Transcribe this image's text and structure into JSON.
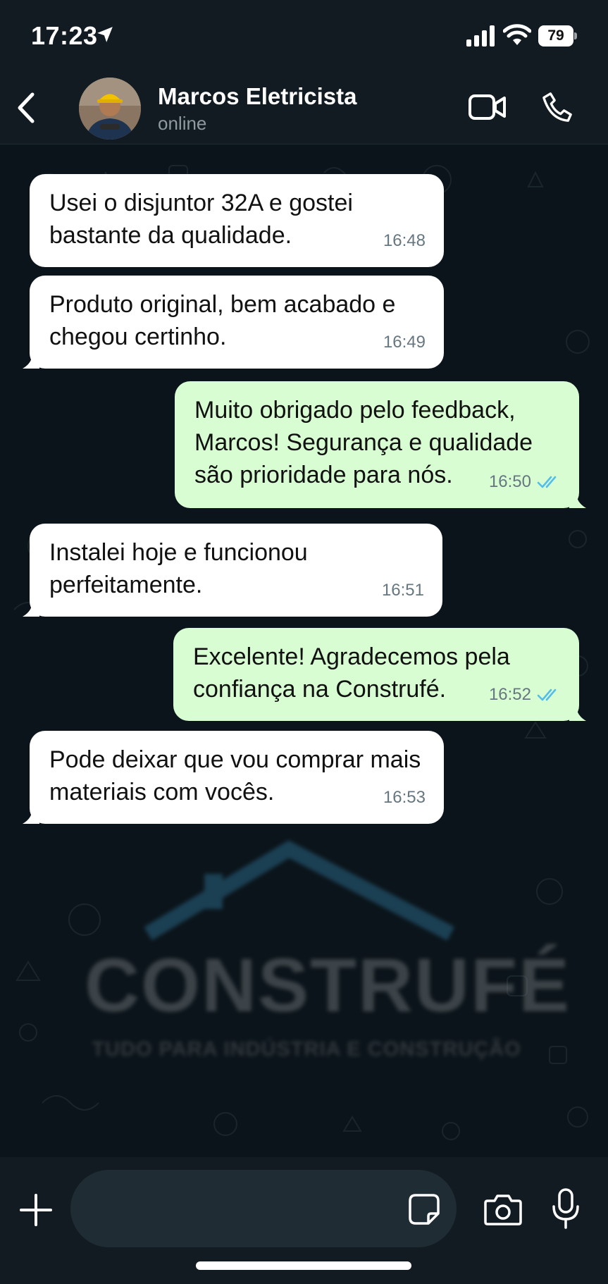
{
  "status_bar": {
    "time": "17:23",
    "battery": "79"
  },
  "header": {
    "contact_name": "Marcos Eletricista",
    "status": "online"
  },
  "messages": [
    {
      "direction": "in",
      "text": "Usei o disjuntor 32A e gostei bastante da qualidade.",
      "time": "16:48"
    },
    {
      "direction": "in",
      "text": "Produto original, bem acabado e chegou certinho.",
      "time": "16:49"
    },
    {
      "direction": "out",
      "text": "Muito obrigado pelo feedback, Marcos! Segurança e qualidade são prioridade para nós.",
      "time": "16:50",
      "status": "read"
    },
    {
      "direction": "in",
      "text": "Instalei hoje e funcionou perfeitamente.",
      "time": "16:51"
    },
    {
      "direction": "out",
      "text": "Excelente! Agradecemos pela confiança na Construfé.",
      "time": "16:52",
      "status": "read"
    },
    {
      "direction": "in",
      "text": "Pode deixar que vou comprar mais materiais com vocês.",
      "time": "16:53"
    }
  ],
  "watermark": {
    "brand": "CONSTRUFÉ",
    "tagline": "TUDO PARA INDÚSTRIA E CONSTRUÇÃO"
  },
  "input": {
    "value": "",
    "placeholder": ""
  },
  "colors": {
    "background": "#0b141a",
    "header": "#111b21",
    "incoming_bubble": "#ffffff",
    "outgoing_bubble": "#d9fdd3",
    "read_ticks": "#53bdeb",
    "timestamp": "#667781"
  },
  "icons": [
    "location-arrow-icon",
    "signal-icon",
    "wifi-icon",
    "back-icon",
    "video-call-icon",
    "phone-icon",
    "plus-icon",
    "sticker-icon",
    "camera-icon",
    "microphone-icon"
  ]
}
